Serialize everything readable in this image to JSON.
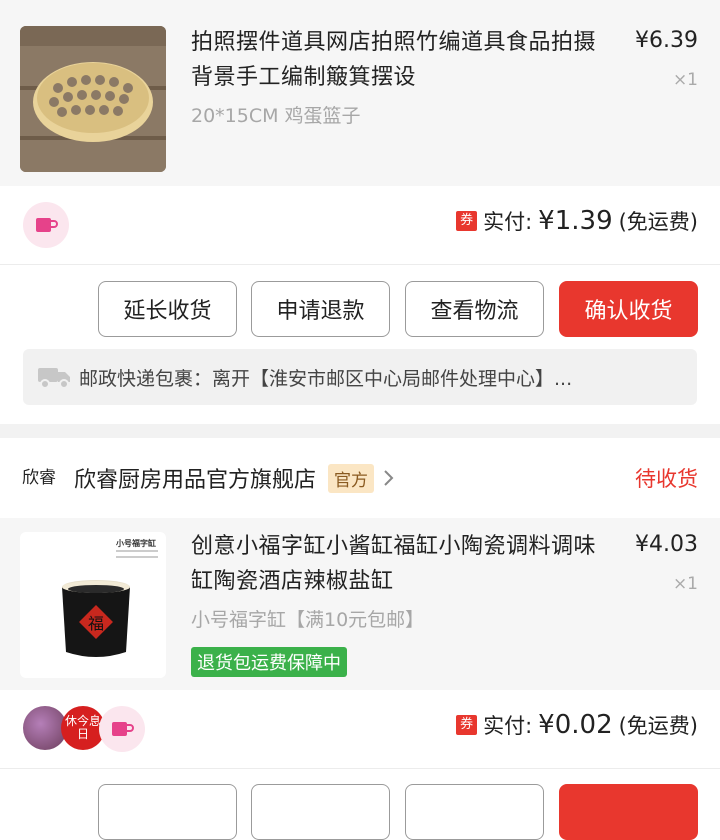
{
  "order1": {
    "product_title": "拍照摆件道具网店拍照竹编道具食品拍摄背景手工编制簸箕摆设",
    "sku": "20*15CM 鸡蛋篮子",
    "price": "¥6.39",
    "qty": "×1",
    "coupon_label": "券",
    "paid_label": "实付:",
    "paid_amount": "¥1.39",
    "shipping_note": "(免运费)",
    "buttons": {
      "extend": "延长收货",
      "refund": "申请退款",
      "logistics": "查看物流",
      "confirm": "确认收货"
    },
    "logistics_text": "邮政快递包裹：离开【淮安市邮区中心局邮件处理中心】..."
  },
  "order2": {
    "shop_logo_text": "欣睿",
    "shop_name": "欣睿厨房用品官方旗舰店",
    "official_badge": "官方",
    "status": "待收货",
    "thumb_label": "小号福字缸",
    "thumb_char": "福",
    "product_title": "创意小福字缸小酱缸福缸小陶瓷调料调味缸陶瓷酒店辣椒盐缸",
    "sku": "小号福字缸【满10元包邮】",
    "guarantee": "退货包运费保障中",
    "price": "¥4.03",
    "qty": "×1",
    "coupon_label": "券",
    "paid_label": "实付:",
    "paid_amount": "¥0.02",
    "shipping_note": "(免运费)",
    "avatar_badge": "休今息日"
  },
  "colors": {
    "accent_red": "#e8372e",
    "guarantee_green": "#3bb14a",
    "official_bg": "#fbe6c4"
  }
}
